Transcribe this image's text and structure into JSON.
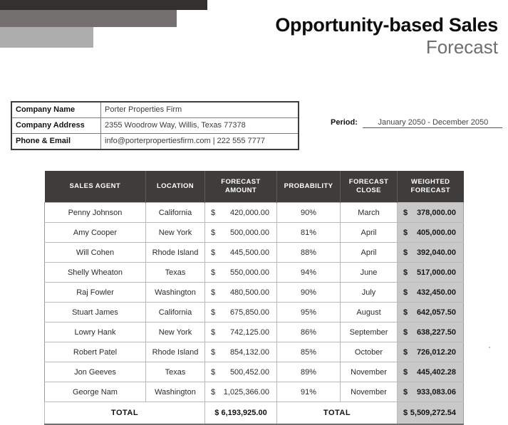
{
  "header": {
    "title_main": "Opportunity-based Sales",
    "title_sub": "Forecast",
    "accent_dark": "#333130",
    "accent_mid": "#747070",
    "accent_light": "#aeaeae"
  },
  "company": {
    "rows": [
      {
        "label": "Company Name",
        "value": "Porter Properties Firm"
      },
      {
        "label": "Company Address",
        "value": "2355 Woodrow Way, Willis, Texas 77378"
      },
      {
        "label": "Phone & Email",
        "value": "info@porterpropertiesfirm.com  |  222 555 7777"
      }
    ]
  },
  "period": {
    "label": "Period:",
    "value": "January 2050 - December 2050"
  },
  "sales_table": {
    "columns": [
      "SALES AGENT",
      "LOCATION",
      "FORECAST AMOUNT",
      "PROBABILITY",
      "FORECAST CLOSE",
      "WEIGHTED FORECAST"
    ],
    "currency_symbol": "$",
    "rows": [
      {
        "agent": "Penny Johnson",
        "location": "California",
        "forecast_amount": "420,000.00",
        "probability": "90%",
        "forecast_close": "March",
        "weighted_forecast": "378,000.00"
      },
      {
        "agent": "Amy Cooper",
        "location": "New York",
        "forecast_amount": "500,000.00",
        "probability": "81%",
        "forecast_close": "April",
        "weighted_forecast": "405,000.00"
      },
      {
        "agent": "Will Cohen",
        "location": "Rhode Island",
        "forecast_amount": "445,500.00",
        "probability": "88%",
        "forecast_close": "April",
        "weighted_forecast": "392,040.00"
      },
      {
        "agent": "Shelly Wheaton",
        "location": "Texas",
        "forecast_amount": "550,000.00",
        "probability": "94%",
        "forecast_close": "June",
        "weighted_forecast": "517,000.00"
      },
      {
        "agent": "Raj Fowler",
        "location": "Washington",
        "forecast_amount": "480,500.00",
        "probability": "90%",
        "forecast_close": "July",
        "weighted_forecast": "432,450.00"
      },
      {
        "agent": "Stuart James",
        "location": "California",
        "forecast_amount": "675,850.00",
        "probability": "95%",
        "forecast_close": "August",
        "weighted_forecast": "642,057.50"
      },
      {
        "agent": "Lowry Hank",
        "location": "New York",
        "forecast_amount": "742,125.00",
        "probability": "86%",
        "forecast_close": "September",
        "weighted_forecast": "638,227.50"
      },
      {
        "agent": "Robert Patel",
        "location": "Rhode Island",
        "forecast_amount": "854,132.00",
        "probability": "85%",
        "forecast_close": "October",
        "weighted_forecast": "726,012.20"
      },
      {
        "agent": "Jon Geeves",
        "location": "Texas",
        "forecast_amount": "500,452.00",
        "probability": "89%",
        "forecast_close": "November",
        "weighted_forecast": "445,402.28"
      },
      {
        "agent": "George Nam",
        "location": "Washington",
        "forecast_amount": "1,025,366.00",
        "probability": "91%",
        "forecast_close": "November",
        "weighted_forecast": "933,083.06"
      }
    ],
    "total": {
      "left_label": "TOTAL",
      "forecast_amount_total": "$ 6,193,925.00",
      "right_label": "TOTAL",
      "weighted_forecast_total": "5,509,272.54"
    },
    "header_bg": "#3f3d3c",
    "weighted_col_bg": "#c9c9c9"
  }
}
